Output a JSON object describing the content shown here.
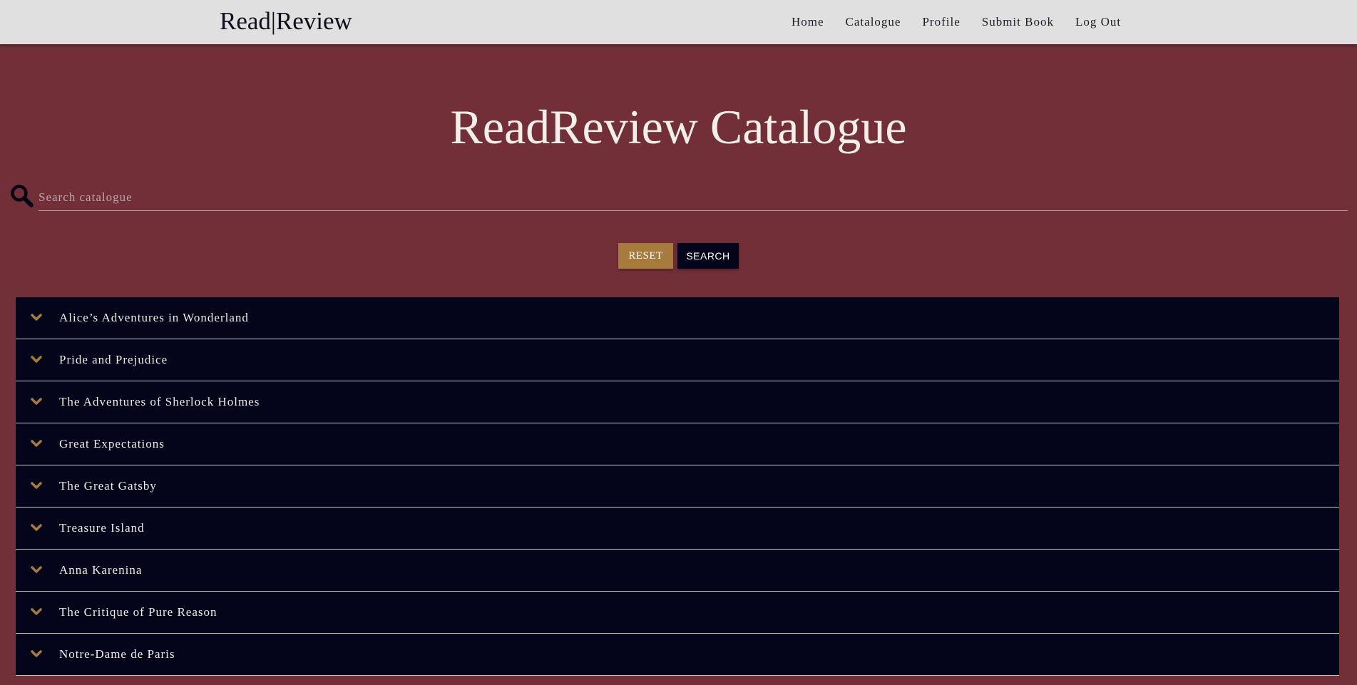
{
  "nav": {
    "brand": "Read|Review",
    "links": [
      {
        "label": "Home"
      },
      {
        "label": "Catalogue"
      },
      {
        "label": "Profile"
      },
      {
        "label": "Submit Book"
      },
      {
        "label": "Log Out"
      }
    ]
  },
  "main": {
    "title": "ReadReview Catalogue",
    "search": {
      "placeholder": "Search catalogue",
      "value": "",
      "icon": "search-icon"
    },
    "buttons": {
      "reset": "RESET",
      "search": "SEARCH"
    },
    "books": [
      {
        "title": "Alice’s Adventures in Wonderland",
        "icon": "chevron-down-icon"
      },
      {
        "title": "Pride and Prejudice",
        "icon": "chevron-down-icon"
      },
      {
        "title": "The Adventures of Sherlock Holmes",
        "icon": "chevron-down-icon"
      },
      {
        "title": "Great Expectations",
        "icon": "chevron-down-icon"
      },
      {
        "title": "The Great Gatsby",
        "icon": "chevron-down-icon"
      },
      {
        "title": "Treasure Island",
        "icon": "chevron-down-icon"
      },
      {
        "title": "Anna Karenina",
        "icon": "chevron-down-icon"
      },
      {
        "title": "The Critique of Pure Reason",
        "icon": "chevron-down-icon"
      },
      {
        "title": "Notre-Dame de Paris",
        "icon": "chevron-down-icon"
      }
    ]
  },
  "colors": {
    "navbar_bg": "#e0e0e0",
    "page_bg": "#722f38",
    "list_bg": "#04041b",
    "accent_gold": "#a67b3c",
    "text_light": "#f3eee8"
  }
}
